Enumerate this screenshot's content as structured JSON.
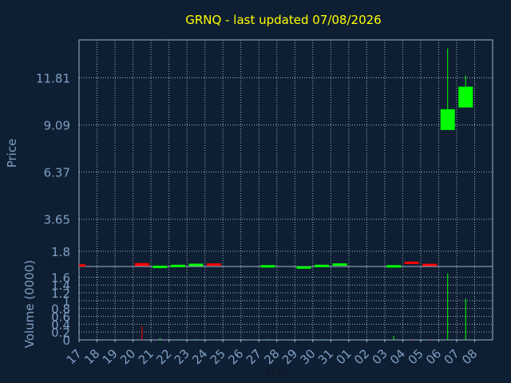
{
  "chart_data": {
    "type": "candlestick",
    "title": "GRNQ - last updated 07/08/2026",
    "xlabel": "Day",
    "ylabel": "Price",
    "volume_label": "Volume (0000)",
    "price_ticks": [
      "1.8",
      "3.65",
      "6.37",
      "9.09",
      "11.81"
    ],
    "volume_ticks": [
      "0",
      "0.2",
      "0.4",
      "0.6",
      "0.8",
      "1",
      "1.2",
      "1.4",
      "1.6"
    ],
    "x_ticks": [
      "17",
      "18",
      "19",
      "20",
      "21",
      "22",
      "23",
      "24",
      "25",
      "26",
      "27",
      "28",
      "29",
      "30",
      "31",
      "01",
      "02",
      "03",
      "04",
      "05",
      "06",
      "07",
      "08"
    ],
    "price_range": [
      0.92,
      14.0
    ],
    "volume_range": [
      0,
      1.75
    ],
    "grid": true,
    "colors": {
      "background": "#0f1f33",
      "title": "#ffff00",
      "axis_text": "#7f9fc4",
      "axis_line": "#9fb3cc",
      "up": "#00ff00",
      "down": "#ff0000"
    },
    "candles": [
      {
        "day": "17",
        "open": 1.05,
        "close": 1.0,
        "high": 1.05,
        "low": 1.0,
        "volume": 0
      },
      {
        "day": "20",
        "open": 1.12,
        "close": 0.95,
        "high": 1.12,
        "low": 0.95,
        "volume": 0.35
      },
      {
        "day": "21",
        "open": 0.9,
        "close": 0.97,
        "high": 0.97,
        "low": 0.9,
        "volume": 0.05
      },
      {
        "day": "22",
        "open": 0.93,
        "close": 1.02,
        "high": 1.02,
        "low": 0.93,
        "volume": 0.02
      },
      {
        "day": "23",
        "open": 1.03,
        "close": 1.08,
        "high": 1.1,
        "low": 1.03,
        "volume": 0.02
      },
      {
        "day": "24",
        "open": 1.1,
        "close": 1.05,
        "high": 1.1,
        "low": 1.05,
        "volume": 0
      },
      {
        "day": "27",
        "open": 0.97,
        "close": 1.0,
        "high": 1.0,
        "low": 0.97,
        "volume": 0.02
      },
      {
        "day": "29",
        "open": 0.9,
        "close": 0.93,
        "high": 0.93,
        "low": 0.9,
        "volume": 0.02
      },
      {
        "day": "30",
        "open": 0.97,
        "close": 1.02,
        "high": 1.02,
        "low": 0.97,
        "volume": 0.02
      },
      {
        "day": "31",
        "open": 1.05,
        "close": 1.1,
        "high": 1.1,
        "low": 1.05,
        "volume": 0
      },
      {
        "day": "03",
        "open": 0.97,
        "close": 1.0,
        "high": 1.0,
        "low": 0.97,
        "volume": 0.1
      },
      {
        "day": "04",
        "open": 1.2,
        "close": 1.07,
        "high": 1.2,
        "low": 1.07,
        "volume": 0.03
      },
      {
        "day": "05",
        "open": 1.08,
        "close": 0.97,
        "high": 1.08,
        "low": 0.97,
        "volume": 0.02
      },
      {
        "day": "06",
        "open": 8.8,
        "close": 10.0,
        "high": 13.5,
        "low": 8.8,
        "volume": 1.7
      },
      {
        "day": "07",
        "open": 10.1,
        "close": 11.3,
        "high": 11.95,
        "low": 10.1,
        "volume": 1.05
      }
    ]
  }
}
